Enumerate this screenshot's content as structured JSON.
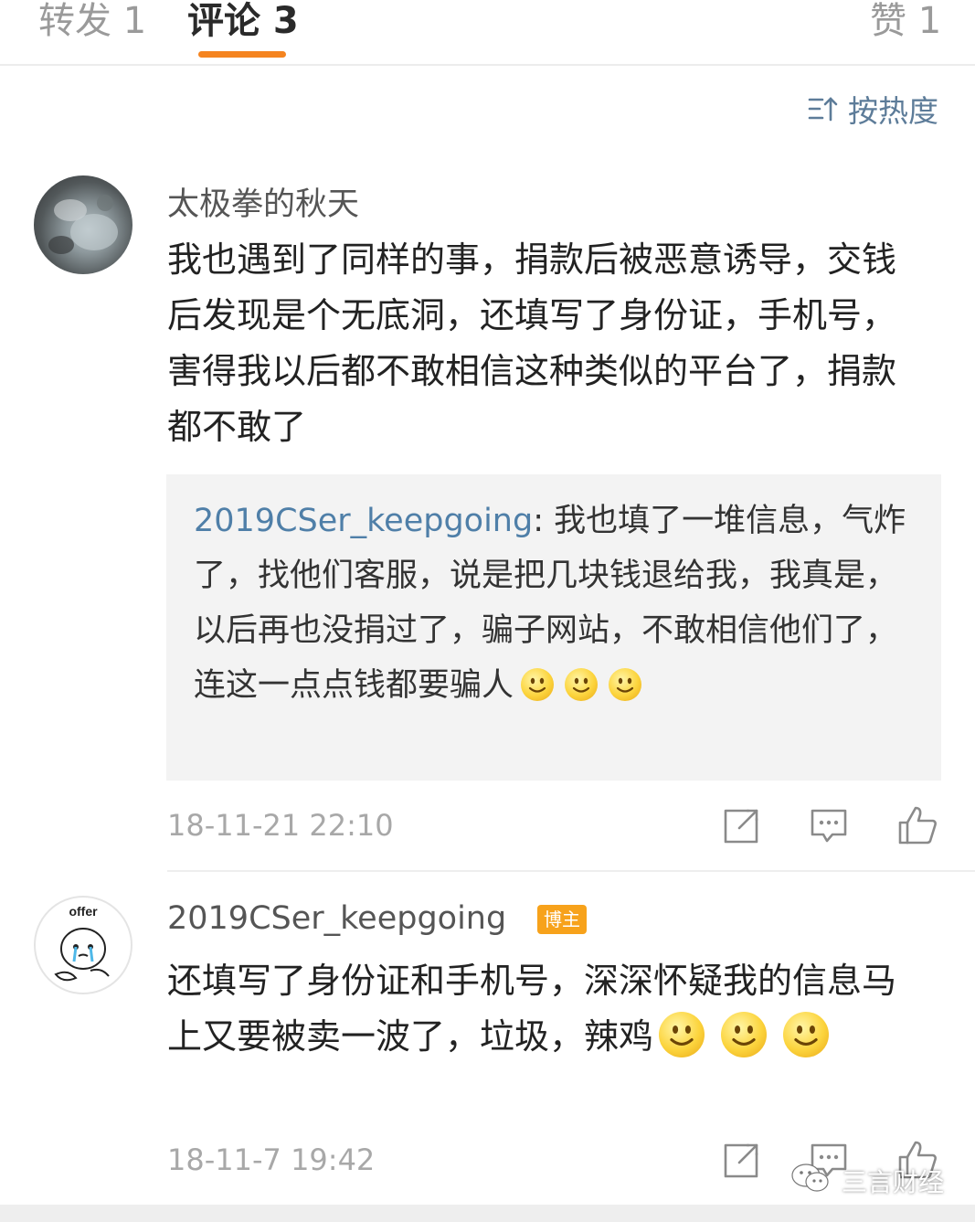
{
  "tabs": [
    {
      "label": "转发 1"
    },
    {
      "label": "评论 3"
    },
    {
      "label": "赞 1"
    }
  ],
  "sort": {
    "label": "按热度"
  },
  "comments": [
    {
      "user": "太极拳的秋天",
      "text": "我也遇到了同样的事，捐款后被恶意诱导，交钱后发现是个无底洞，还填写了身份证，手机号，害得我以后都不敢相信这种类似的平台了，捐款都不敢了",
      "reply": {
        "user": "2019CSer_keepgoing",
        "text": "我也填了一堆信息，气炸了，找他们客服，说是把几块钱退给我，我真是，以后再也没捐过了，骗子网站，不敢相信他们了，连这一点点钱都要骗人"
      },
      "time": "18-11-21 22:10"
    },
    {
      "user": "2019CSer_keepgoing",
      "badge": "博主",
      "avatar_text": "offer",
      "text": "还填写了身份证和手机号，深深怀疑我的信息马上又要被卖一波了，垃圾，辣鸡",
      "time": "18-11-7 19:42"
    }
  ],
  "watermark": {
    "label": "三言财经"
  },
  "colors": {
    "accent": "#f5841f",
    "link": "#4f7fa8",
    "badge": "#f7a21b",
    "muted": "#a8a8a8"
  },
  "icons": [
    "sort-icon",
    "repost-icon",
    "reply-icon",
    "like-icon",
    "smile-emoji",
    "wechat-icon"
  ]
}
